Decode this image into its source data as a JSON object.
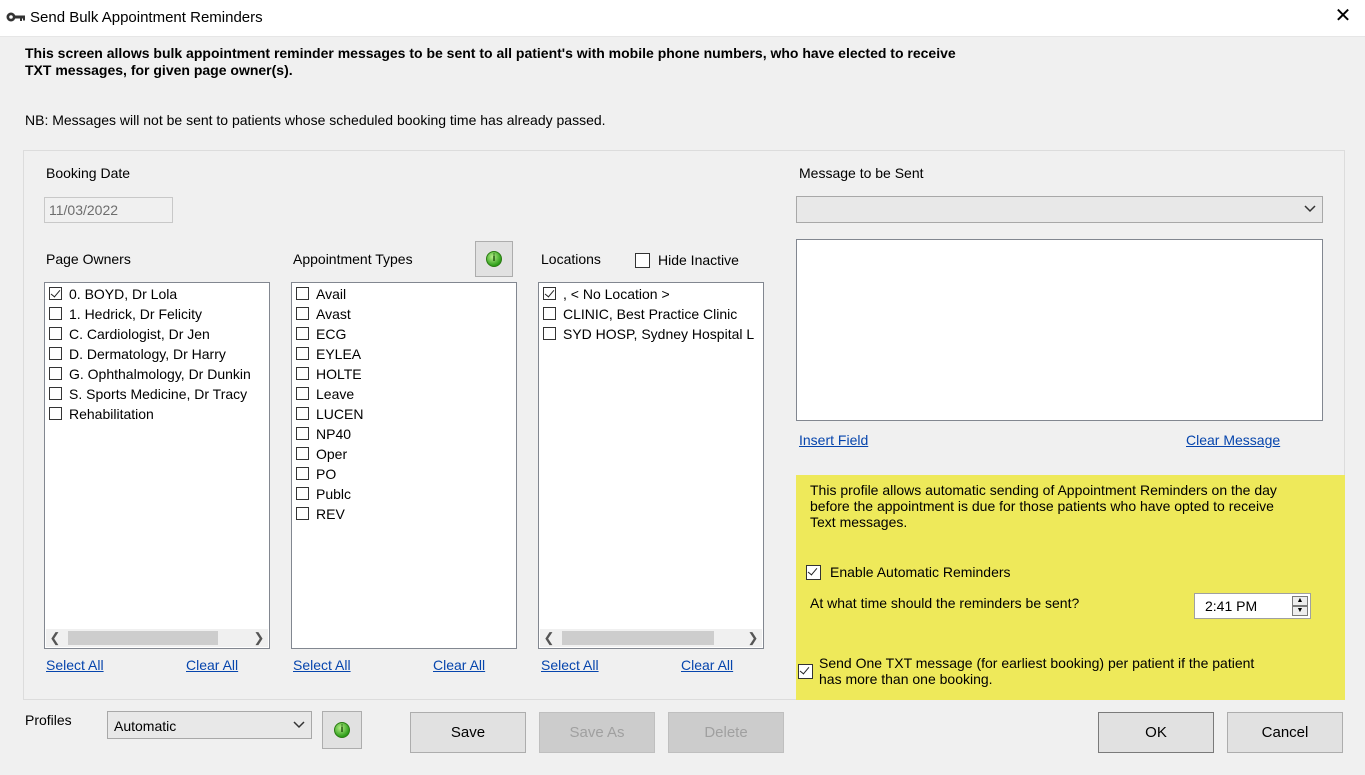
{
  "window": {
    "title": "Send Bulk Appointment Reminders",
    "close_glyph": "✕"
  },
  "intro_text": "This screen allows bulk appointment reminder messages to be sent to all patient's with mobile phone numbers, who have elected to receive TXT messages, for given page owner(s).",
  "nb_text": "NB: Messages will not be sent  to patients whose scheduled booking time has already passed.",
  "booking_date": {
    "label": "Booking Date",
    "value": "11/03/2022"
  },
  "page_owners": {
    "label": "Page Owners",
    "items": [
      {
        "label": "0. BOYD, Dr Lola",
        "checked": true
      },
      {
        "label": "1. Hedrick, Dr Felicity",
        "checked": false
      },
      {
        "label": "C. Cardiologist, Dr Jen",
        "checked": false
      },
      {
        "label": "D. Dermatology, Dr Harry",
        "checked": false
      },
      {
        "label": "G. Ophthalmology, Dr Dunkin",
        "checked": false
      },
      {
        "label": "S. Sports Medicine, Dr Tracy",
        "checked": false
      },
      {
        "label": "Rehabilitation",
        "checked": false
      }
    ],
    "select_all": "Select All",
    "clear_all": "Clear All"
  },
  "appointment_types": {
    "label": "Appointment Types",
    "items": [
      {
        "label": "Avail",
        "checked": false
      },
      {
        "label": "Avast",
        "checked": false
      },
      {
        "label": "ECG",
        "checked": false
      },
      {
        "label": "EYLEA",
        "checked": false
      },
      {
        "label": "HOLTE",
        "checked": false
      },
      {
        "label": "Leave",
        "checked": false
      },
      {
        "label": "LUCEN",
        "checked": false
      },
      {
        "label": "NP40",
        "checked": false
      },
      {
        "label": "Oper",
        "checked": false
      },
      {
        "label": "PO",
        "checked": false
      },
      {
        "label": "Publc",
        "checked": false
      },
      {
        "label": "REV",
        "checked": false
      }
    ],
    "select_all": "Select All",
    "clear_all": "Clear All"
  },
  "locations": {
    "label": "Locations",
    "hide_inactive": {
      "label": "Hide Inactive",
      "checked": false
    },
    "items": [
      {
        "label": ", < No Location >",
        "checked": true
      },
      {
        "label": "CLINIC, Best Practice Clinic",
        "checked": false
      },
      {
        "label": "SYD HOSP, Sydney Hospital L",
        "checked": false
      }
    ],
    "select_all": "Select All",
    "clear_all": "Clear All"
  },
  "message": {
    "label": "Message to be Sent",
    "selected": "",
    "body": "",
    "insert_field": "Insert Field",
    "clear_message": "Clear Message"
  },
  "auto_profile": {
    "description": "This profile allows automatic sending of Appointment Reminders on the day before the appointment is due for those patients who have opted to receive Text messages.",
    "enable_label": "Enable Automatic Reminders",
    "enable_checked": true,
    "time_question": "At what time should the reminders be sent?",
    "time_value": "2:41 PM",
    "one_txt_label": "Send One TXT message (for earliest booking) per patient if the patient has more than one booking.",
    "one_txt_checked": true
  },
  "profiles": {
    "label": "Profiles",
    "selected": "Automatic"
  },
  "buttons": {
    "save": "Save",
    "save_as": "Save As",
    "delete": "Delete",
    "ok": "OK",
    "cancel": "Cancel"
  },
  "colors": {
    "highlight": "#eee95a",
    "link": "#0645ad"
  }
}
